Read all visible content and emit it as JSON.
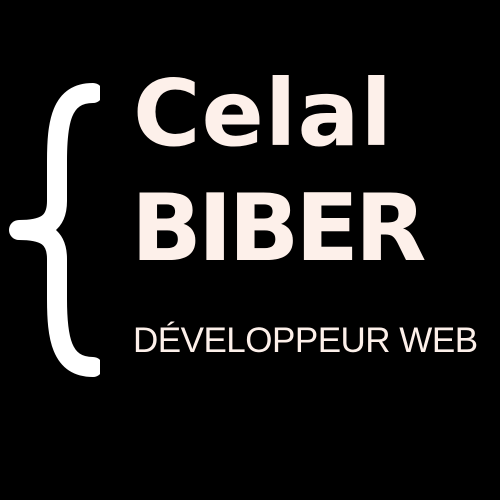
{
  "logo": {
    "brace_glyph": "{",
    "first_name": "Celal",
    "last_name": "BIBER",
    "tagline": "DÉVELOPPEUR WEB"
  },
  "colors": {
    "background": "#000000",
    "text": "#fdf0ea",
    "brace": "#ffffff"
  },
  "icons": {
    "brace": "curly-brace-icon"
  }
}
